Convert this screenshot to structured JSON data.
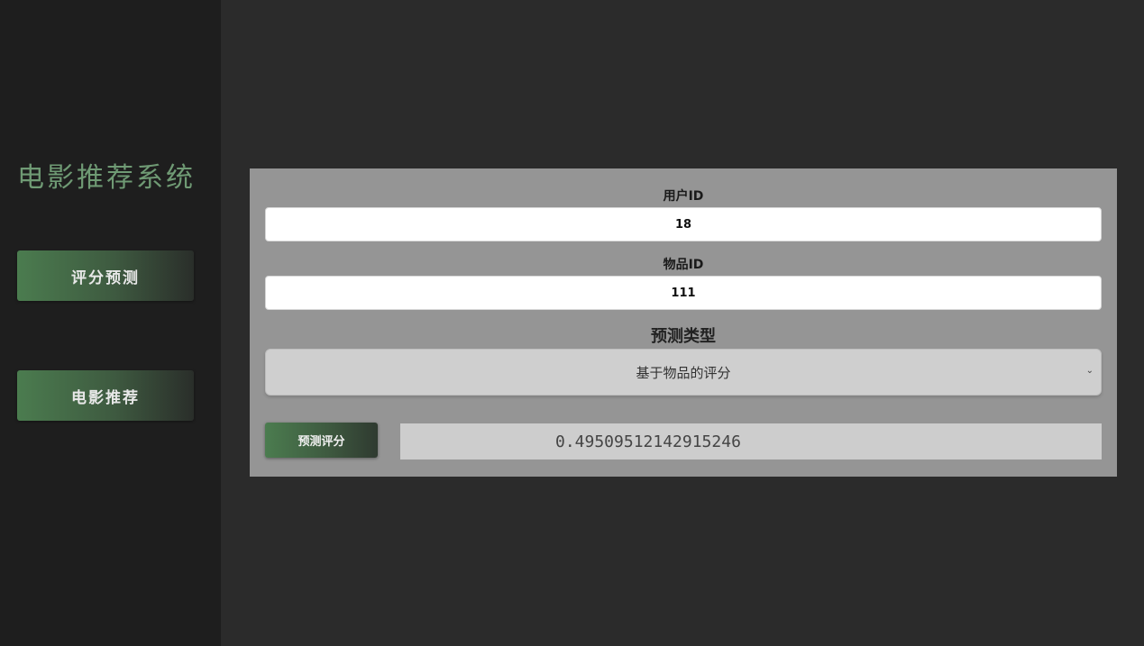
{
  "sidebar": {
    "title": "电影推荐系统",
    "items": [
      {
        "label": "评分预测"
      },
      {
        "label": "电影推荐"
      }
    ]
  },
  "form": {
    "user_id_label": "用户ID",
    "user_id_value": "18",
    "item_id_label": "物品ID",
    "item_id_value": "111",
    "type_label": "预测类型",
    "type_selected": "基于物品的评分",
    "predict_button_label": "预测评分",
    "result_value": "0.49509512142915246"
  },
  "colors": {
    "accent": "#4b7c4f",
    "sidebar_bg": "#1e1e1e",
    "main_bg": "#2b2b2b",
    "panel_bg": "#959595"
  },
  "icons": {
    "select_chevron": "chevron-down-icon"
  }
}
